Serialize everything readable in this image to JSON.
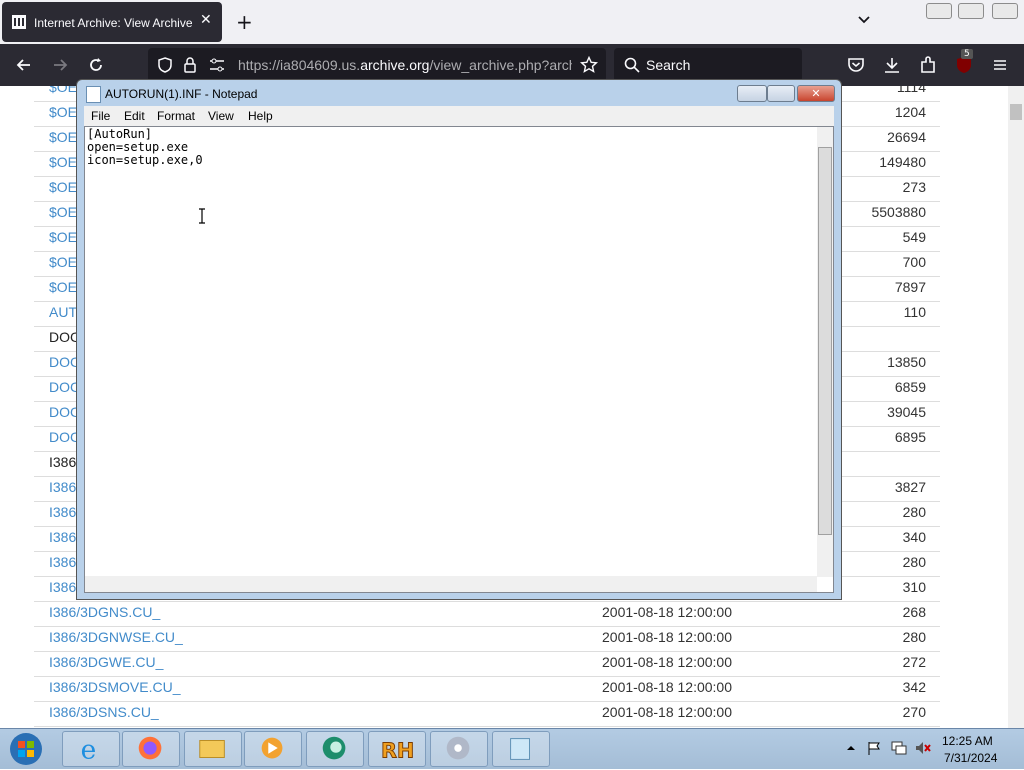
{
  "browser": {
    "tab_title": "Internet Archive: View Archive",
    "url_prefix": "https://ia804609.us.",
    "url_domain": "archive.org",
    "url_path": "/view_archive.php?archi",
    "search_placeholder": "Search",
    "extension_badge": "5"
  },
  "listing": {
    "rows": [
      {
        "name": "$OE",
        "date": "",
        "size": "1114",
        "link": true
      },
      {
        "name": "$OE",
        "date": "",
        "size": "1204",
        "link": true
      },
      {
        "name": "$OE",
        "date": "",
        "size": "26694",
        "link": true
      },
      {
        "name": "$OE",
        "date": "",
        "size": "149480",
        "link": true
      },
      {
        "name": "$OE",
        "date": "",
        "size": "273",
        "link": true
      },
      {
        "name": "$OE",
        "date": "",
        "size": "5503880",
        "link": true
      },
      {
        "name": "$OE",
        "date": "",
        "size": "549",
        "link": true
      },
      {
        "name": "$OE",
        "date": "",
        "size": "700",
        "link": true
      },
      {
        "name": "$OE",
        "date": "",
        "size": "7897",
        "link": true
      },
      {
        "name": "AUT",
        "date": "",
        "size": "110",
        "link": true
      },
      {
        "name": "DOC",
        "date": "",
        "size": "",
        "link": false
      },
      {
        "name": "DOC",
        "date": "",
        "size": "13850",
        "link": true
      },
      {
        "name": "DOC",
        "date": "",
        "size": "6859",
        "link": true
      },
      {
        "name": "DOC",
        "date": "",
        "size": "39045",
        "link": true
      },
      {
        "name": "DOC",
        "date": "",
        "size": "6895",
        "link": true
      },
      {
        "name": "I386",
        "date": "",
        "size": "",
        "link": false
      },
      {
        "name": "I386",
        "date": "",
        "size": "3827",
        "link": true
      },
      {
        "name": "I386",
        "date": "",
        "size": "280",
        "link": true
      },
      {
        "name": "I386",
        "date": "",
        "size": "340",
        "link": true
      },
      {
        "name": "I386",
        "date": "",
        "size": "280",
        "link": true
      },
      {
        "name": "I386",
        "date": "",
        "size": "310",
        "link": true
      },
      {
        "name": "I386/3DGNS.CU_",
        "date": "2001-08-18 12:00:00",
        "size": "268",
        "link": true
      },
      {
        "name": "I386/3DGNWSE.CU_",
        "date": "2001-08-18 12:00:00",
        "size": "280",
        "link": true
      },
      {
        "name": "I386/3DGWE.CU_",
        "date": "2001-08-18 12:00:00",
        "size": "272",
        "link": true
      },
      {
        "name": "I386/3DSMOVE.CU_",
        "date": "2001-08-18 12:00:00",
        "size": "342",
        "link": true
      },
      {
        "name": "I386/3DSNS.CU_",
        "date": "2001-08-18 12:00:00",
        "size": "270",
        "link": true
      }
    ]
  },
  "notepad": {
    "title": "AUTORUN(1).INF - Notepad",
    "menu": [
      "File",
      "Edit",
      "Format",
      "View",
      "Help"
    ],
    "content": "[AutoRun]\nopen=setup.exe\nicon=setup.exe,0"
  },
  "taskbar": {
    "time": "12:25 AM",
    "date": "7/31/2024",
    "pinned": [
      "ie-icon",
      "firefox-icon",
      "explorer-icon",
      "media-player-icon",
      "app-icon",
      "resource-hacker-icon",
      "dvd-icon",
      "notepad-icon"
    ]
  },
  "colors": {
    "link": "#428bca",
    "browser_dark": "#2b2a33"
  }
}
